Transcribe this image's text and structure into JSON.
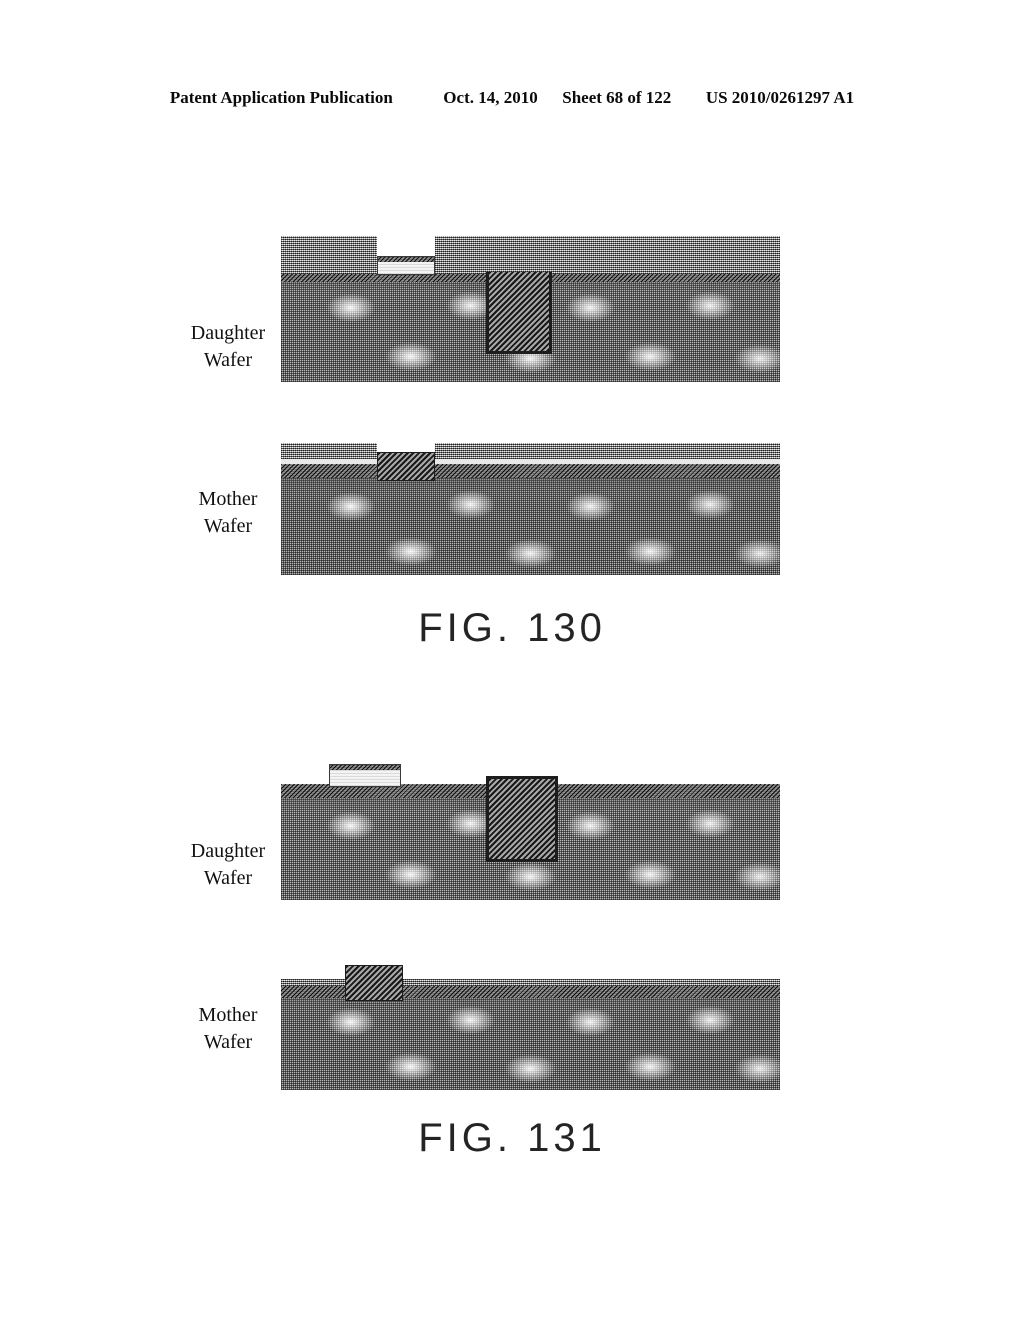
{
  "header": {
    "publication": "Patent Application Publication",
    "date": "Oct. 14, 2010",
    "sheet": "Sheet 68 of 122",
    "patent_number": "US 2010/0261297 A1"
  },
  "figures": [
    {
      "caption": "FIG. 130",
      "panels": [
        {
          "label_line1": "Daughter",
          "label_line2": "Wafer",
          "description": "Cross-section of daughter wafer with patterned mask opening at left and a deep filled trench at right"
        },
        {
          "label_line1": "Mother",
          "label_line2": "Wafer",
          "description": "Cross-section of mother wafer with a shallow recess filled by a dark block at left"
        }
      ]
    },
    {
      "caption": "FIG. 131",
      "panels": [
        {
          "label_line1": "Daughter",
          "label_line2": "Wafer",
          "description": "Cross-section of daughter wafer with raised light block on surface at left and protruding filled trench at right"
        },
        {
          "label_line1": "Mother",
          "label_line2": "Wafer",
          "description": "Cross-section of mother wafer with a raised dark block protruding above the surface layer at left"
        }
      ]
    }
  ],
  "colors": {
    "ink": "#0a0a0a",
    "caption": "#242424",
    "bulk_grey": "#b9b9b9",
    "dark_band": "#6d6d6d",
    "trench_outline": "#1d1d1d",
    "light_block": "#f3f3f3"
  }
}
